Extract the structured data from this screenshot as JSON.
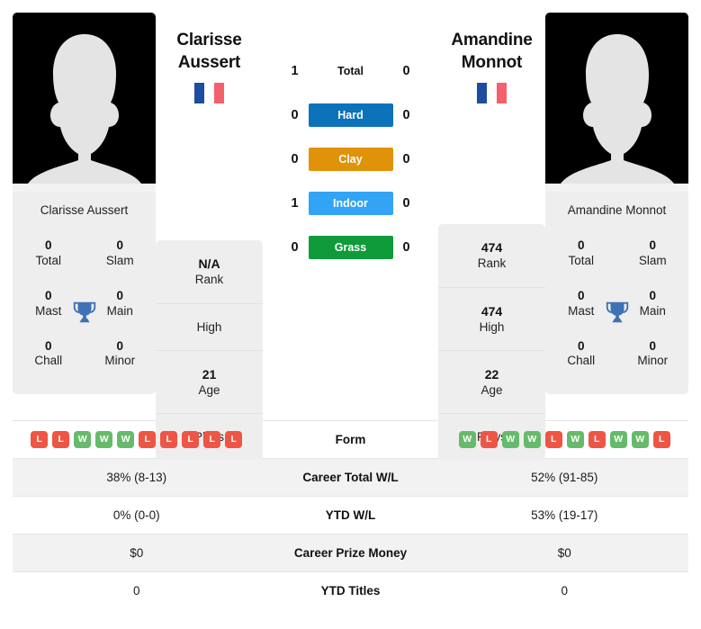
{
  "colors": {
    "hard": "#0c72ba",
    "clay": "#e09208",
    "indoor": "#33a3f5",
    "grass": "#109b3b",
    "win": "#66bb6a",
    "loss": "#ef5544",
    "panel": "#eeeeee",
    "row_alt": "#f2f2f2",
    "trophy": "#3f72b5",
    "flag_blue": "#1c4da1",
    "flag_red": "#f4606c"
  },
  "players": {
    "left": {
      "first_name": "Clarisse",
      "last_name": "Aussert",
      "full_name": "Clarisse Aussert",
      "flag": "france-flag",
      "avatar": "player-silhouette",
      "titles": [
        {
          "value": "0",
          "label": "Total"
        },
        {
          "value": "0",
          "label": "Slam"
        },
        {
          "value": "0",
          "label": "Mast"
        },
        {
          "value": "0",
          "label": "Main"
        },
        {
          "value": "0",
          "label": "Chall"
        },
        {
          "value": "0",
          "label": "Minor"
        }
      ],
      "info": [
        {
          "value": "N/A",
          "label": "Rank"
        },
        {
          "value": "",
          "label": "High"
        },
        {
          "value": "21",
          "label": "Age"
        },
        {
          "value": "",
          "label": "Plays"
        }
      ],
      "form": [
        "L",
        "L",
        "W",
        "W",
        "W",
        "L",
        "L",
        "L",
        "L",
        "L"
      ],
      "career_total_wl": "38% (8-13)",
      "ytd_wl": "0% (0-0)",
      "career_prize_money": "$0",
      "ytd_titles": "0"
    },
    "right": {
      "first_name": "Amandine",
      "last_name": "Monnot",
      "full_name": "Amandine Monnot",
      "flag": "france-flag",
      "avatar": "player-silhouette",
      "titles": [
        {
          "value": "0",
          "label": "Total"
        },
        {
          "value": "0",
          "label": "Slam"
        },
        {
          "value": "0",
          "label": "Mast"
        },
        {
          "value": "0",
          "label": "Main"
        },
        {
          "value": "0",
          "label": "Chall"
        },
        {
          "value": "0",
          "label": "Minor"
        }
      ],
      "info": [
        {
          "value": "474",
          "label": "Rank"
        },
        {
          "value": "474",
          "label": "High"
        },
        {
          "value": "22",
          "label": "Age"
        },
        {
          "value": "",
          "label": "Plays"
        }
      ],
      "form": [
        "W",
        "L",
        "W",
        "W",
        "L",
        "W",
        "L",
        "W",
        "W",
        "L"
      ],
      "career_total_wl": "52% (91-85)",
      "ytd_wl": "53% (19-17)",
      "career_prize_money": "$0",
      "ytd_titles": "0"
    }
  },
  "head_to_head": [
    {
      "label": "Total",
      "left": "1",
      "right": "0",
      "surface": false,
      "color": ""
    },
    {
      "label": "Hard",
      "left": "0",
      "right": "0",
      "surface": true,
      "color": "#0c72ba"
    },
    {
      "label": "Clay",
      "left": "0",
      "right": "0",
      "surface": true,
      "color": "#e09208"
    },
    {
      "label": "Indoor",
      "left": "1",
      "right": "0",
      "surface": true,
      "color": "#33a3f5"
    },
    {
      "label": "Grass",
      "left": "0",
      "right": "0",
      "surface": true,
      "color": "#109b3b"
    }
  ],
  "stats_table": {
    "rows": [
      {
        "label": "Form",
        "type": "form"
      },
      {
        "label": "Career Total W/L",
        "type": "text",
        "key": "career_total_wl"
      },
      {
        "label": "YTD W/L",
        "type": "text",
        "key": "ytd_wl"
      },
      {
        "label": "Career Prize Money",
        "type": "text",
        "key": "career_prize_money"
      },
      {
        "label": "YTD Titles",
        "type": "text",
        "key": "ytd_titles"
      }
    ]
  }
}
